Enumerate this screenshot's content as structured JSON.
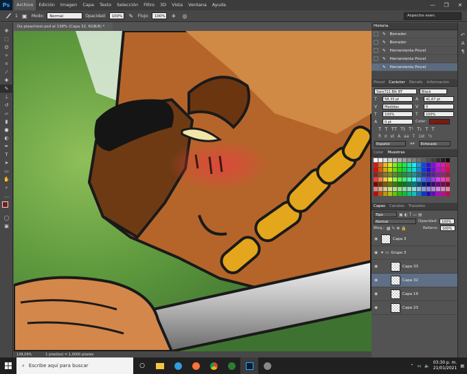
{
  "app": {
    "logo": "Ps"
  },
  "menu": [
    "Archivo",
    "Edición",
    "Imagen",
    "Capa",
    "Texto",
    "Selección",
    "Filtro",
    "3D",
    "Vista",
    "Ventana",
    "Ayuda"
  ],
  "window_buttons": [
    "—",
    "❐",
    "✕"
  ],
  "options": {
    "brush_size": "1",
    "mode_label": "Modo:",
    "mode_value": "Normal",
    "opacity_label": "Opacidad:",
    "opacity_value": "100%",
    "flow_label": "Flujo:",
    "flow_value": "100%"
  },
  "workspace": "Aspectos esen.",
  "document": {
    "tab": "Da pieachiest.psd al 138% (Capa 32, RGB/8) *"
  },
  "status": {
    "zoom": "138,09%",
    "info": "1 píxel(es) = 1,0000 píxeles"
  },
  "history": {
    "title": "Historia",
    "items": [
      "Borrador",
      "Borrador",
      "Herramienta Pincel",
      "Herramienta Pincel",
      "Herramienta Pincel"
    ]
  },
  "character": {
    "tabs": [
      "Pincel",
      "Carácter",
      "Párrafo",
      "Información"
    ],
    "font": "Swis721 Blk BT",
    "style": "Black",
    "size": "58,33 pt",
    "leading": "41,67 pt",
    "kerning": "Medidas",
    "tracking": "0",
    "vscale": "100%",
    "hscale": "100%",
    "baseline": "0 pt",
    "color_label": "Color:",
    "color": "#7a1a14",
    "language": "Español",
    "aa_label": "aa",
    "antialias": "Enfocado"
  },
  "color_panel": {
    "tabs": [
      "Color",
      "Muestras"
    ]
  },
  "layers": {
    "tabs": [
      "Capas",
      "Canales",
      "Trazados"
    ],
    "filter": "Tipo",
    "blend": "Normal",
    "opacity_label": "Opacidad:",
    "opacity": "100%",
    "lock_label": "Bloq.:",
    "fill_label": "Relleno:",
    "fill": "100%",
    "rows": [
      {
        "name": "Capa 3",
        "kind": "layer"
      },
      {
        "name": "Grupo 3",
        "kind": "group"
      },
      {
        "name": "Capa 33",
        "kind": "layer"
      },
      {
        "name": "Capa 32",
        "kind": "layer"
      },
      {
        "name": "Capa 19",
        "kind": "layer"
      },
      {
        "name": "Capa 23",
        "kind": "layer"
      }
    ]
  },
  "taskbar": {
    "search_placeholder": "Escribe aquí para buscar",
    "time": "03:30 p. m.",
    "date": "21/01/2021"
  }
}
